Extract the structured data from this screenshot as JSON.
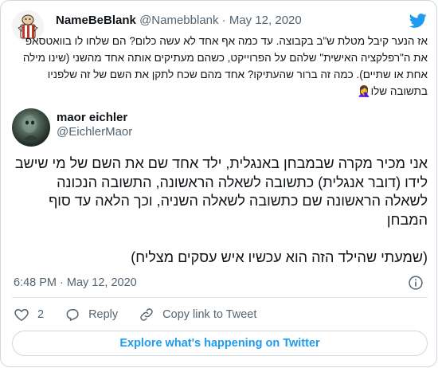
{
  "quoted_tweet": {
    "display_name": "NameBeBlank",
    "handle_and_date": "@Namebblank · May 12, 2020",
    "text": "אז הנער קיבל מטלת ש\"ב בקבוצה. עד כמה אף אחד לא עשה כלום? הם שלחו לו בוואטסאפ את ה\"רפלקציה האישית\" שלהם על הפרוייקט, כשהם מעתיקים אותה אחד מהשני (שינו מילה אחת או שתיים). כמה זה ברור שהעתיקו? אחד מהם שכח לתקן את השם של זה שלפניו בתשובה שלו🤦‍♀️"
  },
  "author": {
    "display_name": "maor eichler",
    "handle": "@EichlerMaor"
  },
  "tweet": {
    "text": "אני מכיר מקרה שבמבחן באנגלית, ילד אחד שם את השם של מי שישב לידו (דובר אנגלית) כתשובה לשאלה הראשונה, התשובה הנכונה לשאלה הראשונה שם כתשובה לשאלה השניה, וכך הלאה עד סוף המבחן\n\n(שמעתי שהילד הזה הוא עכשיו איש עסקים מצליח)",
    "timestamp": "6:48 PM · May 12, 2020"
  },
  "actions": {
    "like_count": "2",
    "reply_label": "Reply",
    "copy_link_label": "Copy link to Tweet"
  },
  "explore_label": "Explore what's happening on Twitter",
  "colors": {
    "accent": "#1d9bf0",
    "muted": "#536471",
    "border": "#cfd9de"
  },
  "icons": [
    "twitter-bird-icon",
    "info-icon",
    "heart-icon",
    "reply-icon",
    "link-icon"
  ]
}
